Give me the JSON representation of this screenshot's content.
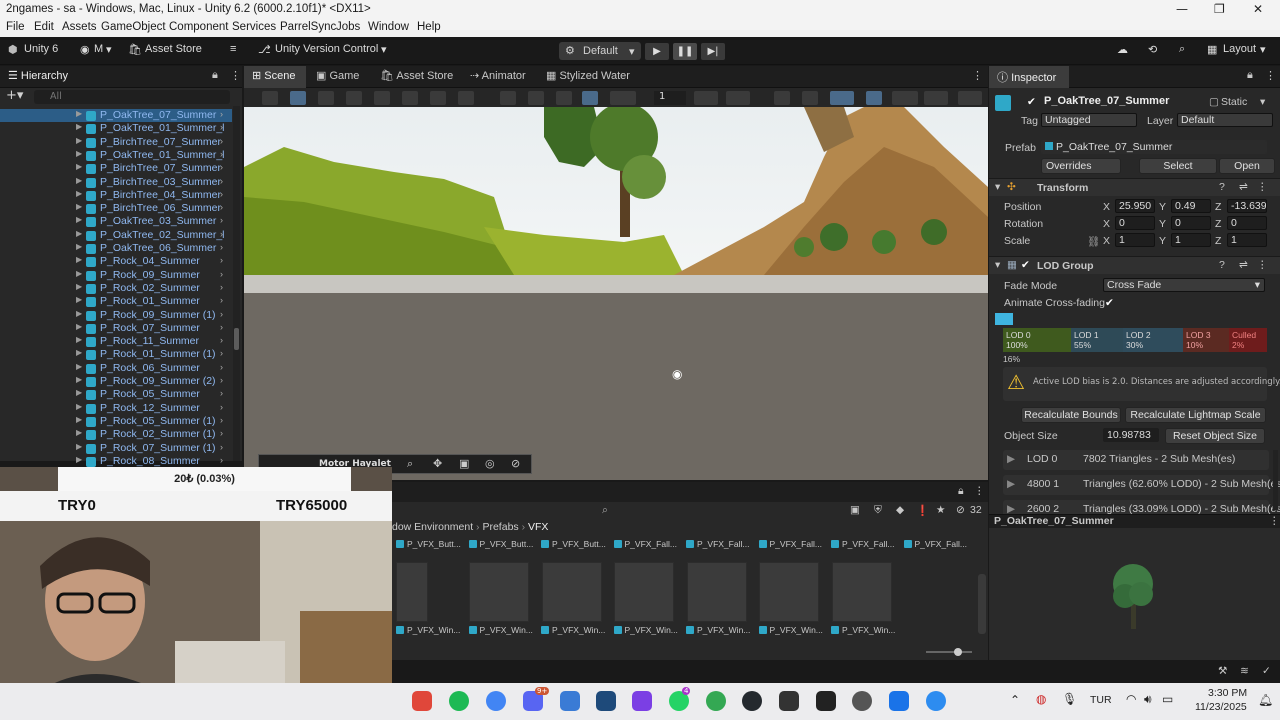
{
  "window": {
    "title": "2ngames - sa - Windows, Mac, Linux - Unity 6.2 (6000.2.10f1)* <DX11>"
  },
  "menu": [
    "File",
    "Edit",
    "Assets",
    "GameObject",
    "Component",
    "Services",
    "ParrelSync",
    "Jobs",
    "Window",
    "Help"
  ],
  "toolbar": {
    "unity": "Unity 6",
    "account": "M",
    "asset_store": "Asset Store",
    "version_control": "Unity Version Control",
    "layout_preset": "Default",
    "layout": "Layout"
  },
  "hierarchy": {
    "title": "Hierarchy",
    "search_placeholder": "All",
    "items": [
      "P_OakTree_07_Summer",
      "P_OakTree_01_Summer_l",
      "P_BirchTree_07_Summer",
      "P_OakTree_01_Summer_l",
      "P_BirchTree_07_Summer",
      "P_BirchTree_03_Summer",
      "P_BirchTree_04_Summer",
      "P_BirchTree_06_Summer",
      "P_OakTree_03_Summer",
      "P_OakTree_02_Summer_l",
      "P_OakTree_06_Summer",
      "P_Rock_04_Summer",
      "P_Rock_09_Summer",
      "P_Rock_02_Summer",
      "P_Rock_01_Summer",
      "P_Rock_09_Summer (1)",
      "P_Rock_07_Summer",
      "P_Rock_11_Summer",
      "P_Rock_01_Summer (1)",
      "P_Rock_06_Summer",
      "P_Rock_09_Summer (2)",
      "P_Rock_05_Summer",
      "P_Rock_12_Summer",
      "P_Rock_05_Summer (1)",
      "P_Rock_02_Summer (1)",
      "P_Rock_07_Summer (1)",
      "P_Rock_08_Summer"
    ]
  },
  "scene_tabs": [
    "Scene",
    "Game",
    "Asset Store",
    "Animator",
    "Stylized Water"
  ],
  "scene": {
    "layer_count": "1"
  },
  "inspector": {
    "title": "Inspector",
    "object_name": "P_OakTree_07_Summer",
    "static_label": "Static",
    "tag_label": "Tag",
    "tag_value": "Untagged",
    "layer_label": "Layer",
    "layer_value": "Default",
    "prefab_label": "Prefab",
    "prefab_value": "P_OakTree_07_Summer",
    "overrides": "Overrides",
    "select": "Select",
    "open": "Open",
    "transform": {
      "title": "Transform",
      "position_label": "Position",
      "rotation_label": "Rotation",
      "scale_label": "Scale",
      "pos": [
        "25.950",
        "0.49",
        "-13.639"
      ],
      "rot": [
        "0",
        "0",
        "0"
      ],
      "scale": [
        "1",
        "1",
        "1"
      ]
    },
    "lod": {
      "title": "LOD Group",
      "fade_mode_label": "Fade Mode",
      "fade_mode": "Cross Fade",
      "animate_label": "Animate Cross-fading",
      "levels": [
        {
          "name": "LOD 0",
          "pct": "100%",
          "color": "#3f5a1e"
        },
        {
          "name": "LOD 1",
          "pct": "55%",
          "color": "#2e4a57"
        },
        {
          "name": "LOD 2",
          "pct": "30%",
          "color": "#2f4c5c"
        },
        {
          "name": "LOD 3",
          "pct": "10%",
          "color": "#5b2a22"
        },
        {
          "name": "Culled",
          "pct": "2%",
          "color": "#6e1c1c"
        }
      ],
      "current_pct": "16%",
      "warning": "Active LOD bias is 2.0. Distances are adjusted accordingly.",
      "recalc_bounds": "Recalculate Bounds",
      "recalc_lightmap": "Recalculate Lightmap Scale",
      "object_size_label": "Object Size",
      "object_size": "10.98783",
      "reset_size": "Reset Object Size",
      "rows": [
        {
          "name": "LOD 0",
          "info": "7802 Triangles  - 2 Sub Mesh(es)"
        },
        {
          "name": "4800 1",
          "info": "Triangles (62.60% LOD0) - 2 Sub Mesh(es)"
        },
        {
          "name": "2600 2",
          "info": "Triangles (33.09% LOD0) - 2 Sub Mesh(es)"
        }
      ]
    },
    "axes": [
      "X",
      "Y",
      "Z"
    ]
  },
  "preview": {
    "title": "P_OakTree_07_Summer"
  },
  "project": {
    "breadcrumb": [
      "dow Environment",
      "Prefabs",
      "VFX"
    ],
    "count": "32",
    "top_labels": [
      "P_VFX_Butt...",
      "P_VFX_Butt...",
      "P_VFX_Butt...",
      "P_VFX_Fall...",
      "P_VFX_Fall...",
      "P_VFX_Fall...",
      "P_VFX_Fall...",
      "P_VFX_Fall..."
    ],
    "bottom_labels": [
      "P_VFX_Win...",
      "P_VFX_Win...",
      "P_VFX_Win...",
      "P_VFX_Win...",
      "P_VFX_Win...",
      "P_VFX_Win...",
      "P_VFX_Win..."
    ]
  },
  "overlay": {
    "progress": "20₺ (0.03%)",
    "left": "TRY0",
    "right": "TRY65000",
    "caption": "Motor Hayalet"
  },
  "taskbar": {
    "lang": "TUR",
    "time": "3:30 PM",
    "date": "11/23/2025",
    "badge": "9+",
    "badge2": "4"
  }
}
